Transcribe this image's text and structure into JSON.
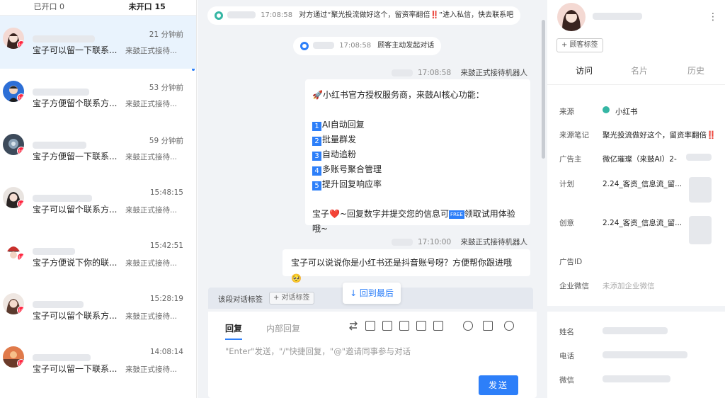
{
  "left": {
    "tabs": [
      {
        "label": "已开口 0"
      },
      {
        "label": "未开口 15"
      }
    ],
    "conversations": [
      {
        "time": "21 分钟前",
        "message": "宝子可以留一下联系...",
        "sub": "来鼓正式接待...",
        "selected": true
      },
      {
        "time": "53 分钟前",
        "message": "宝子方便留个联系方...",
        "sub": "来鼓正式接待..."
      },
      {
        "time": "59 分钟前",
        "message": "宝子方便留一下联系...",
        "sub": "来鼓正式接待..."
      },
      {
        "time": "15:48:15",
        "message": "宝子可以留个联系方...",
        "sub": "来鼓正式接待..."
      },
      {
        "time": "15:42:51",
        "message": "宝子方便说下你的联...",
        "sub": "来鼓正式接待..."
      },
      {
        "time": "15:28:19",
        "message": "宝子可以留个联系方...",
        "sub": "来鼓正式接待..."
      },
      {
        "time": "14:08:14",
        "message": "宝子可以留一下联系...",
        "sub": "来鼓正式接待..."
      }
    ],
    "badge_text": "小红书"
  },
  "chat": {
    "sys1": {
      "time": "17:08:58",
      "text": "对方通过“聚光投流做好这个，留资率翻倍‼️”进入私信，快去联系吧"
    },
    "sys2": {
      "time": "17:08:58",
      "text": "顾客主动发起对话"
    },
    "msg1": {
      "time": "17:08:58",
      "sender": "来鼓正式接待机器人",
      "title": "🚀小红书官方授权服务商，来鼓AI核心功能：",
      "items": [
        {
          "n": "1",
          "text": "AI自动回复"
        },
        {
          "n": "2",
          "text": "批量群发"
        },
        {
          "n": "3",
          "text": "自动追粉"
        },
        {
          "n": "4",
          "text": "多账号聚合管理"
        },
        {
          "n": "5",
          "text": "提升回复响应率"
        }
      ],
      "cta_pre": "宝子",
      "cta_heart": "❤️",
      "cta_mid": "~回复数字并提交您的信息可",
      "cta_free": "FREE",
      "cta_post": "领取试用体验哦~"
    },
    "msg2": {
      "time": "17:10:00",
      "sender": "来鼓正式接待机器人",
      "text": "宝子可以说说你是小红书还是抖音账号呀？方便帮你跟进哦🥺"
    },
    "tag_label": "该段对话标签",
    "tag_button": "+ 对话标签",
    "scroll_bottom": "↓ 回到最后",
    "composer": {
      "tabs": [
        {
          "label": "回复"
        },
        {
          "label": "内部回复"
        }
      ],
      "placeholder": "\"Enter\"发送，\"/\"快捷回复，\"@\"邀请同事参与对话",
      "send": "发送"
    }
  },
  "right": {
    "tag_button": "+ 顾客标签",
    "tabs": [
      {
        "label": "访问"
      },
      {
        "label": "名片"
      },
      {
        "label": "历史"
      }
    ],
    "fields": [
      {
        "label": "来源",
        "value": "小红书"
      },
      {
        "label": "来源笔记",
        "value": "聚光投流做好这个，留资率翻倍‼️"
      },
      {
        "label": "广告主",
        "value": "微亿璀璨（来鼓AI）2-"
      },
      {
        "label": "计划",
        "value": "2.24_客资_信息流_留..."
      },
      {
        "label": "创意",
        "value": "2.24_客资_信息流_留..."
      },
      {
        "label": "广告ID",
        "value": ""
      },
      {
        "label": "企业微信",
        "value": "未添加企业微信"
      }
    ],
    "contact": [
      {
        "label": "姓名"
      },
      {
        "label": "电话"
      },
      {
        "label": "微信"
      }
    ]
  },
  "colors": {
    "accent": "#2d7ff9",
    "selected_bg": "#e9f3fd",
    "chat_bg": "#f1f3f6",
    "xhs_red": "#ff2741"
  }
}
